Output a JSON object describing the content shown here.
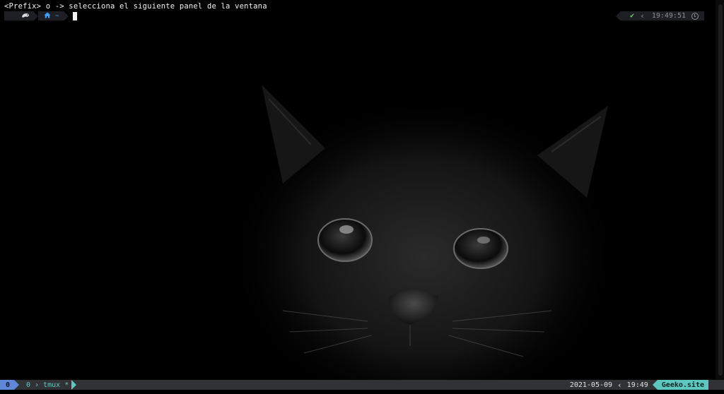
{
  "terminal": {
    "message": "<Prefix> o -> selecciona el siguiente panel de la ventana",
    "prompt": {
      "os_icon": "opensuse-chameleon-icon",
      "dir_icon": "home-icon",
      "dir": "~"
    },
    "right_prompt": {
      "status_icon": "check-icon",
      "status": "✔",
      "time": "19:49:51",
      "time_icon": "clock-icon"
    }
  },
  "tmux": {
    "session": "0",
    "windows": [
      {
        "index": "0",
        "name": "tmux",
        "flag": "*"
      }
    ],
    "date": "2021-05-09",
    "time": "19:49",
    "host": "Geeko.site"
  },
  "colors": {
    "session_bg": "#5f87d7",
    "window_fg": "#5ec8c0",
    "host_bg": "#5ec8c0",
    "status_bg": "#303236"
  }
}
